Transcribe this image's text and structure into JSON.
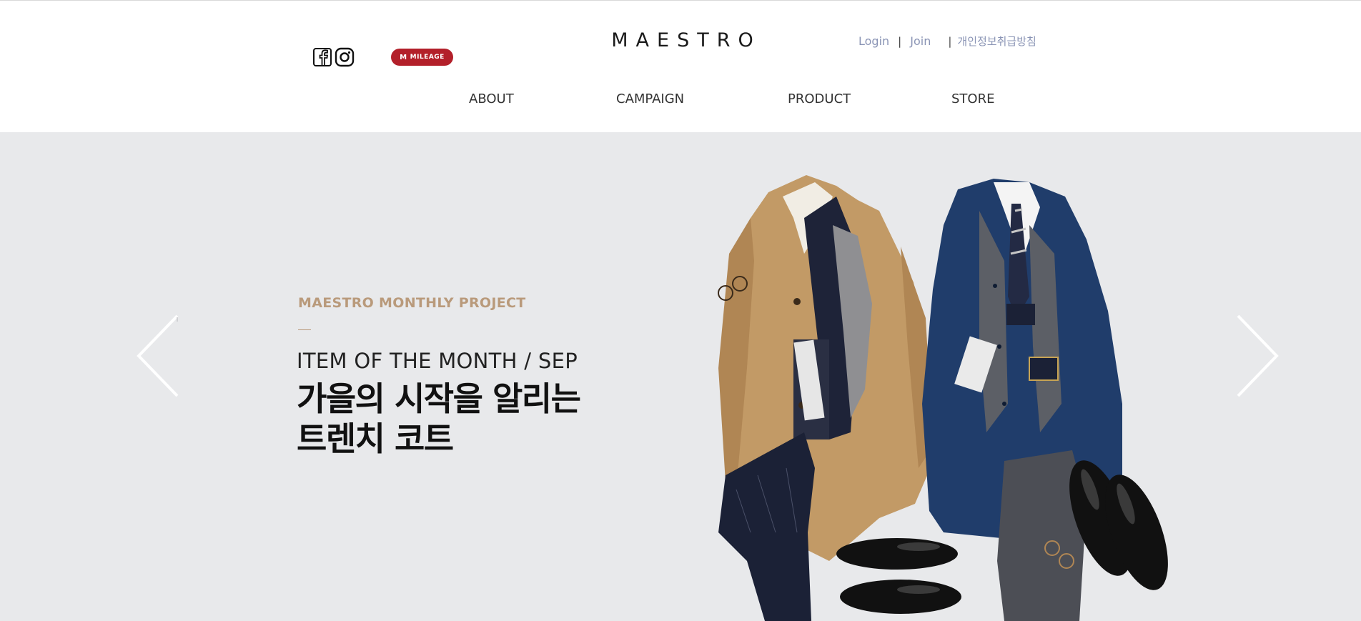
{
  "header": {
    "logo": "MAESTRO",
    "mileage_label": "MILEAGE",
    "mileage_mark": "M",
    "login": "Login",
    "join": "Join",
    "privacy": "개인정보취급방침",
    "separator": "|",
    "social_icons": [
      "facebook-icon",
      "instagram-icon"
    ]
  },
  "nav": {
    "items": [
      {
        "label": "ABOUT"
      },
      {
        "label": "CAMPAIGN"
      },
      {
        "label": "PRODUCT"
      },
      {
        "label": "STORE"
      }
    ]
  },
  "hero": {
    "eyebrow": "MAESTRO MONTHLY PROJECT",
    "subtitle": "ITEM OF THE MONTH / SEP",
    "headline_line1": "가을의 시작을 알리는",
    "headline_line2": "트렌치 코트",
    "prev_icon": "chevron-left-icon",
    "next_icon": "chevron-right-icon"
  },
  "colors": {
    "hero_bg": "#e8e9eb",
    "accent_gold": "#b99a7b",
    "mileage_red": "#b3202a",
    "util_link": "#8a94b5",
    "camel_coat": "#c29a66",
    "navy_coat": "#203d6b"
  }
}
